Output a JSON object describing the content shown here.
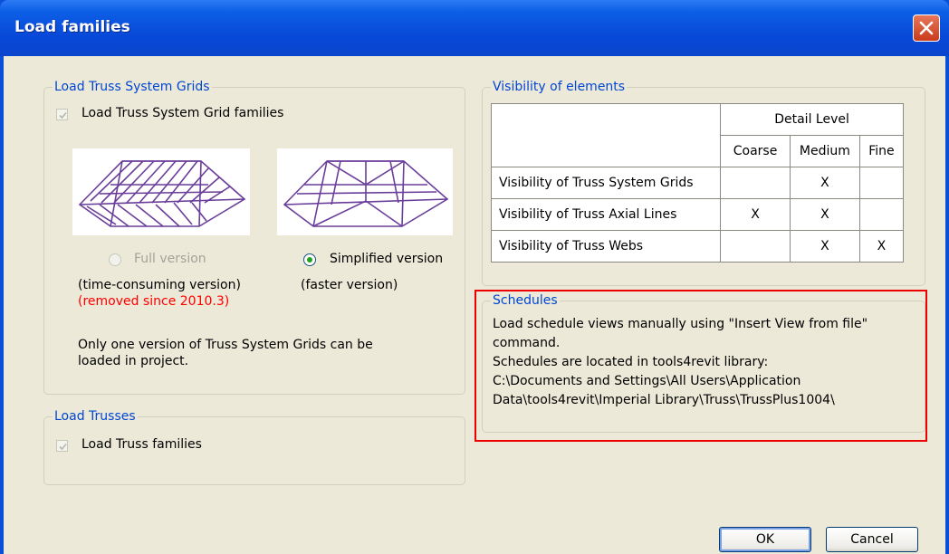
{
  "window": {
    "title": "Load families"
  },
  "truss_grids": {
    "legend": "Load Truss System Grids",
    "checkbox_label": "Load Truss System Grid families",
    "full": {
      "label": "Full version",
      "note1": "(time-consuming version)",
      "note2": "(removed since 2010.3)"
    },
    "simplified": {
      "label": "Simplified version",
      "note1": "(faster version)"
    },
    "info_line1": "Only one version of Truss System Grids can be",
    "info_line2": "loaded in project."
  },
  "trusses": {
    "legend": "Load Trusses",
    "checkbox_label": "Load Truss families"
  },
  "visibility": {
    "legend": "Visibility of elements",
    "header_group": "Detail Level",
    "columns": [
      "Coarse",
      "Medium",
      "Fine"
    ],
    "rows": [
      {
        "label": "Visibility of Truss System Grids",
        "cells": [
          "",
          "X",
          ""
        ]
      },
      {
        "label": "Visibility of Truss Axial Lines",
        "cells": [
          "X",
          "X",
          ""
        ]
      },
      {
        "label": "Visibility of Truss Webs",
        "cells": [
          "",
          "X",
          "X"
        ]
      }
    ]
  },
  "schedules": {
    "legend": "Schedules",
    "lines": [
      "Load schedule views manually using \"Insert View from file\"",
      "command.",
      "Schedules are located in tools4revit library:",
      "C:\\Documents and Settings\\All Users\\Application",
      "Data\\tools4revit\\Imperial Library\\Truss\\TrussPlus1004\\"
    ]
  },
  "buttons": {
    "ok": "OK",
    "cancel": "Cancel"
  },
  "colors": {
    "legend": "#0046d5",
    "highlight": "#ee0000",
    "roof": "#6a3d9a"
  }
}
